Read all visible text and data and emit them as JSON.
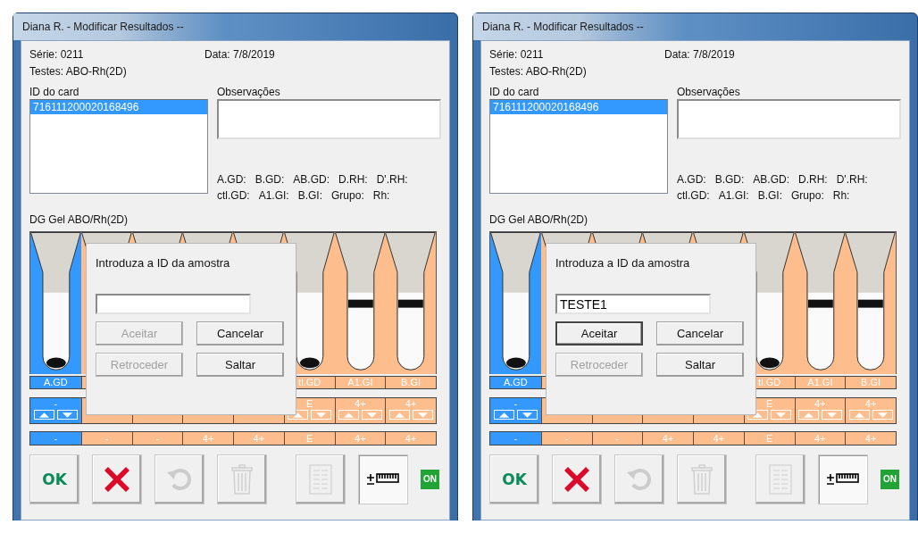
{
  "windows": [
    {
      "title": "Diana R. - Modificar Resultados --",
      "serie": "Série: 0211",
      "data": "Data: 7/8/2019",
      "testes": "Testes: ABO-Rh(2D)",
      "card_list": {
        "label": "ID do card",
        "items": [
          {
            "text": "716111200020168496",
            "selected": true
          }
        ]
      },
      "observacoes": {
        "label": "Observações"
      },
      "result_labels": [
        [
          "A.GD:",
          "B.GD:",
          "AB.GD:",
          "D.RH:",
          "D'.RH:"
        ],
        [
          "ctl.GD:",
          "A1.GI:",
          "B.GI:",
          "Grupo:",
          "Rh:"
        ]
      ],
      "gel_title": "DG Gel ABO/Rh(2D)",
      "columns": [
        {
          "label": "A.GD",
          "selected": true,
          "grade": "-",
          "arrows": true,
          "result": "-"
        },
        {
          "selected": false,
          "arrows": false,
          "result": "-"
        },
        {
          "selected": false,
          "arrows": false,
          "result": "-"
        },
        {
          "selected": false,
          "arrows": false,
          "result": "4+"
        },
        {
          "selected": false,
          "arrows": false,
          "result": "4+"
        },
        {
          "label": "tl.GD",
          "selected": false,
          "grade": "E",
          "arrows": true,
          "result": "E"
        },
        {
          "label": "A1.GI",
          "selected": false,
          "grade": "4+",
          "arrows": true,
          "result": "4+"
        },
        {
          "label": "B.GI",
          "selected": false,
          "grade": "4+",
          "arrows": true,
          "result": "4+"
        }
      ],
      "dialog": {
        "title": "Introduza a ID da amostra",
        "buttons": [
          {
            "label": "Aceitar",
            "disabled": true
          },
          {
            "label": "Cancelar",
            "disabled": false
          },
          {
            "label": "Retroceder",
            "disabled": true
          },
          {
            "label": "Saltar",
            "disabled": false
          }
        ]
      },
      "toolbar": [
        {
          "kind": "ok",
          "label": "OK",
          "disabled": false,
          "pressed": false
        },
        {
          "kind": "cancel",
          "disabled": false,
          "pressed": false
        },
        {
          "kind": "undo",
          "disabled": true,
          "pressed": false
        },
        {
          "kind": "delete",
          "disabled": true,
          "pressed": false
        },
        {
          "kind": "report",
          "disabled": true,
          "pressed": false
        },
        {
          "kind": "scale",
          "disabled": false,
          "pressed": true
        }
      ],
      "badge": "ON"
    },
    {
      "title": "Diana R. - Modificar Resultados --",
      "serie": "Série: 0211",
      "data": "Data: 7/8/2019",
      "testes": "Testes: ABO-Rh(2D)",
      "card_list": {
        "label": "ID do card",
        "items": [
          {
            "text": "716111200020168496",
            "selected": true
          }
        ]
      },
      "observacoes": {
        "label": "Observações"
      },
      "result_labels": [
        [
          "A.GD:",
          "B.GD:",
          "AB.GD:",
          "D.RH:",
          "D'.RH:"
        ],
        [
          "ctl.GD:",
          "A1.GI:",
          "B.GI:",
          "Grupo:",
          "Rh:"
        ]
      ],
      "gel_title": "DG Gel ABO/Rh(2D)",
      "columns": [
        {
          "label": "A.GD",
          "selected": true,
          "grade": "-",
          "arrows": true,
          "result": "-"
        },
        {
          "selected": false,
          "arrows": false,
          "result": "-"
        },
        {
          "selected": false,
          "arrows": false,
          "result": "-"
        },
        {
          "selected": false,
          "arrows": false,
          "result": "4+"
        },
        {
          "selected": false,
          "arrows": false,
          "result": "4+"
        },
        {
          "label": "tl.GD",
          "selected": false,
          "grade": "E",
          "arrows": true,
          "result": "E"
        },
        {
          "label": "A1.GI",
          "selected": false,
          "grade": "4+",
          "arrows": true,
          "result": "4+"
        },
        {
          "label": "B.GI",
          "selected": false,
          "grade": "4+",
          "arrows": true,
          "result": "4+"
        }
      ],
      "dialog": {
        "title": "Introduza a ID da amostra",
        "input_value": "TESTE1",
        "buttons": [
          {
            "label": "Aceitar",
            "disabled": false
          },
          {
            "label": "Cancelar",
            "disabled": false
          },
          {
            "label": "Retroceder",
            "disabled": true
          },
          {
            "label": "Saltar",
            "disabled": false
          }
        ]
      },
      "toolbar": [
        {
          "kind": "ok",
          "label": "OK",
          "disabled": false,
          "pressed": false
        },
        {
          "kind": "cancel",
          "disabled": false,
          "pressed": false
        },
        {
          "kind": "undo",
          "disabled": true,
          "pressed": false
        },
        {
          "kind": "delete",
          "disabled": true,
          "pressed": false
        },
        {
          "kind": "report",
          "disabled": true,
          "pressed": false
        },
        {
          "kind": "scale",
          "disabled": false,
          "pressed": true
        }
      ],
      "badge": "ON"
    }
  ]
}
